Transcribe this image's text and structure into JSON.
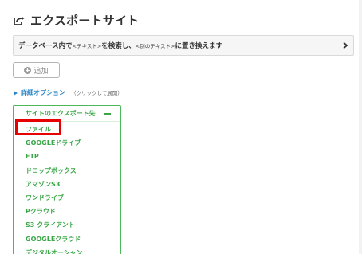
{
  "header": {
    "title": "エクスポートサイト",
    "icon": "export-icon"
  },
  "action_bar": {
    "part1": "データベース内で",
    "placeholder_from": "<テキスト>",
    "part2": " を検索し、",
    "placeholder_to": "<別のテキスト>",
    "part3": "に置き換えます",
    "icon": "chevron-right-icon"
  },
  "add_button": {
    "label": "追加",
    "icon": "plus-circle-icon"
  },
  "advanced": {
    "label": "詳細オプション",
    "hint": "（クリックして展開）",
    "icon": "triangle-right-icon"
  },
  "destinations": {
    "header": "サイトのエクスポート先",
    "collapse_icon": "minus-icon",
    "items": [
      {
        "label": "ファイル",
        "selected": true
      },
      {
        "label": "GOOGLEドライブ"
      },
      {
        "label": "FTP"
      },
      {
        "label": "ドロップボックス"
      },
      {
        "label": "アマゾンS3"
      },
      {
        "label": "ワンドライブ"
      },
      {
        "label": "Pクラウド"
      },
      {
        "label": "S3 クライアント"
      },
      {
        "label": "GOOGLEクラウド"
      },
      {
        "label": "デジタルオーシャン"
      }
    ]
  },
  "colors": {
    "accent_green": "#3aa648",
    "link_blue": "#2a85c7",
    "highlight_red": "#e60000"
  }
}
